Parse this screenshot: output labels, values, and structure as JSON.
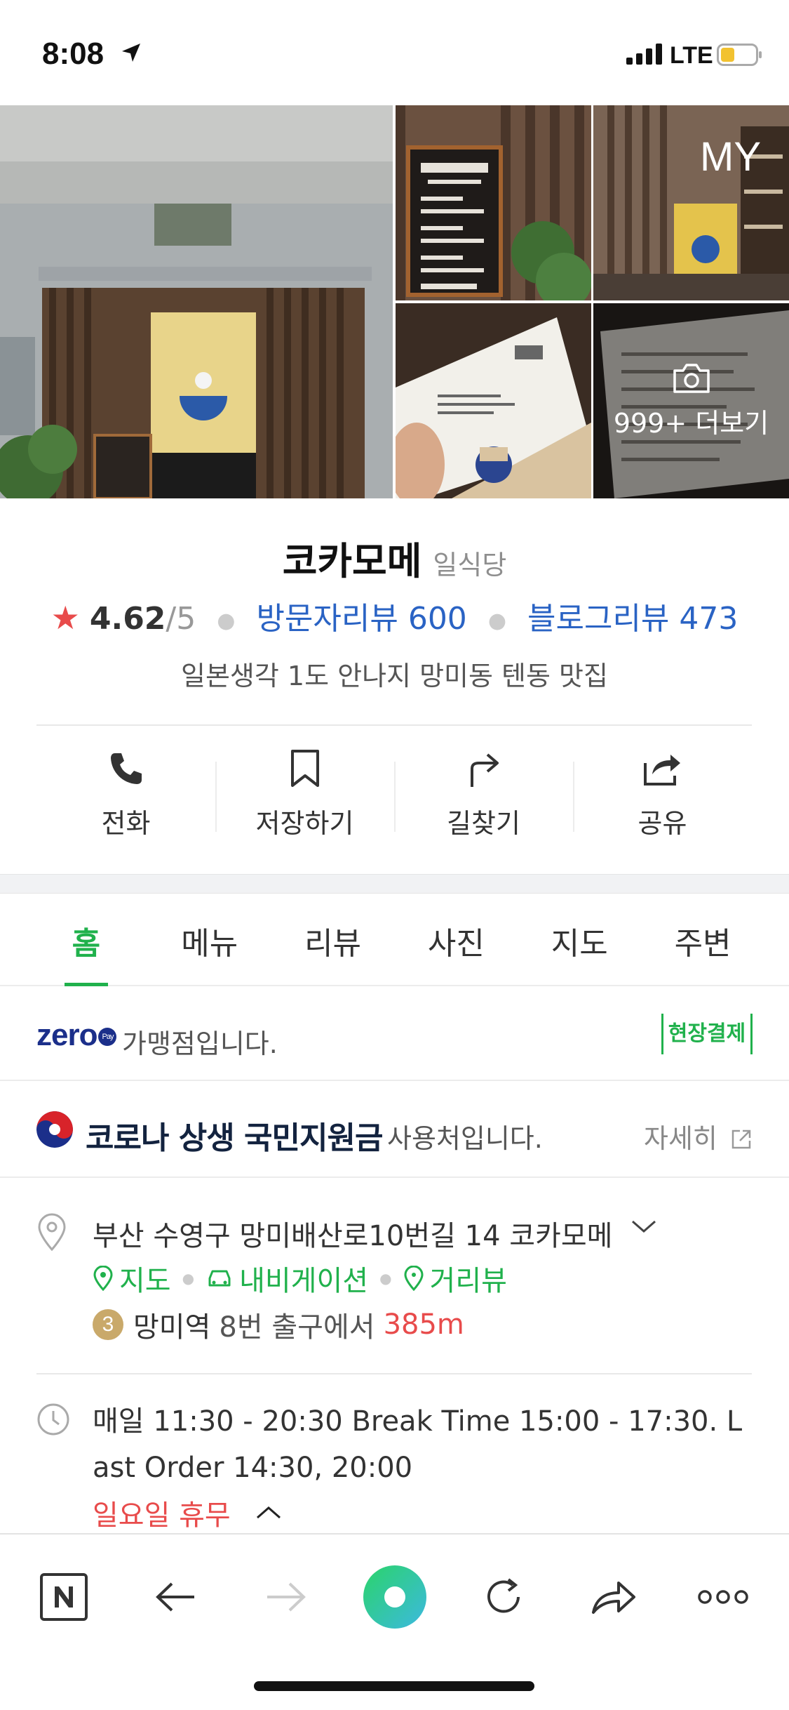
{
  "status_bar": {
    "time": "8:08",
    "network": "LTE"
  },
  "photos": {
    "my_label": "MY",
    "more_label": "999+ 더보기"
  },
  "place": {
    "name": "코카모메",
    "category": "일식당",
    "rating": "4.62",
    "rating_max": "/5",
    "visitor_reviews": "방문자리뷰 600",
    "blog_reviews": "블로그리뷰 473",
    "description": "일본생각 1도 안나지 망미동 텐동 맛집"
  },
  "actions": [
    {
      "label": "전화",
      "icon": "phone-icon"
    },
    {
      "label": "저장하기",
      "icon": "bookmark-icon"
    },
    {
      "label": "길찾기",
      "icon": "directions-icon"
    },
    {
      "label": "공유",
      "icon": "share-icon"
    }
  ],
  "tabs": [
    "홈",
    "메뉴",
    "리뷰",
    "사진",
    "지도",
    "주변"
  ],
  "zero_pay": {
    "logo": "zero",
    "logo_badge": "Pay",
    "text": "가맹점입니다.",
    "badge": "현장결제"
  },
  "covid": {
    "bold": "코로나 상생 국민지원금",
    "text": "사용처입니다.",
    "detail": "자세히"
  },
  "address": {
    "text": "부산 수영구 망미배산로10번길 14 코카모메",
    "links": [
      "지도",
      "내비게이션",
      "거리뷰"
    ],
    "subway_line": "3",
    "station": "망미역",
    "exit": "8번 출구에서",
    "distance": "385m"
  },
  "hours": {
    "text": "매일 11:30 - 20:30 Break Time 15:00 - 17:30. Last Order 14:30, 20:00",
    "closed": "일요일 휴무"
  },
  "colors": {
    "accent": "#20b14c",
    "link": "#2a63c4",
    "alert": "#e84b4b"
  }
}
